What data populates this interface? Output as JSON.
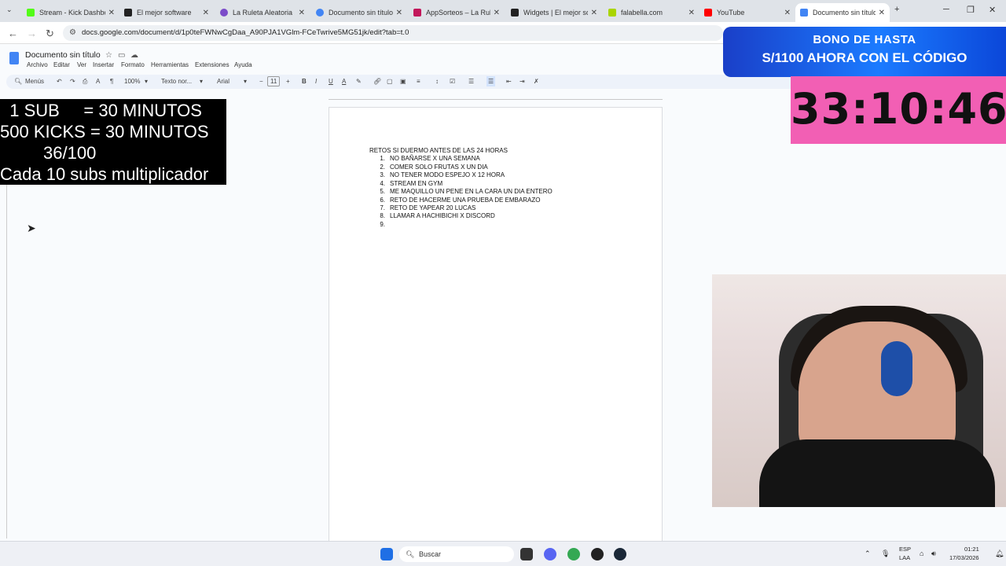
{
  "browser": {
    "tabs": [
      {
        "title": "Stream - Kick Dashboard",
        "color": "#53fc18"
      },
      {
        "title": "El mejor software",
        "color": "#222222"
      },
      {
        "title": "La Ruleta Aleatoria",
        "color": "#7b4cc9"
      },
      {
        "title": "Documento sin título",
        "color": "#4285f4"
      },
      {
        "title": "AppSorteos – La Ruleta",
        "color": "#c2185b"
      },
      {
        "title": "Widgets | El mejor so",
        "color": "#222222"
      },
      {
        "title": "falabella.com",
        "color": "#aad500"
      },
      {
        "title": "YouTube",
        "color": "#ff0000"
      },
      {
        "title": "Documento sin título",
        "color": "#4285f4"
      }
    ],
    "url": "docs.google.com/document/d/1p0teFWNwCgDaa_A90PJA1VGlm-FCeTwrive5MG51jk/edit?tab=t.0"
  },
  "docs": {
    "title": "Documento sin título",
    "menu": [
      "Archivo",
      "Editar",
      "Ver",
      "Insertar",
      "Formato",
      "Herramientas",
      "Extensiones",
      "Ayuda"
    ],
    "toolbar": {
      "menus": "Menús",
      "zoom": "100%",
      "style": "Texto nor...",
      "font": "Arial",
      "size": "11"
    }
  },
  "document": {
    "heading": "RETOS SI DUERMO ANTES DE LAS 24 HORAS",
    "items": [
      {
        "n": "1.",
        "text": "NO BAÑARSE X UNA SEMANA"
      },
      {
        "n": "2.",
        "text": "COMER SOLO FRUTAS X UN DIA"
      },
      {
        "n": "3.",
        "text": "NO TENER MODO ESPEJO X 12 HORA"
      },
      {
        "n": "4.",
        "text": "STREAM EN GYM"
      },
      {
        "n": "5.",
        "text": "ME MAQUILLO UN PENE EN LA CARA UN DIA ENTERO"
      },
      {
        "n": "6.",
        "text": "RETO DE HACERME UNA PRUEBA DE EMBARAZO"
      },
      {
        "n": "7.",
        "text": "RETO DE YAPEAR 20 LUCAS"
      },
      {
        "n": "8.",
        "text": "LLAMAR A HACHIBICHI X DISCORD"
      },
      {
        "n": "9.",
        "text": ""
      }
    ]
  },
  "overlay": {
    "subs": [
      "  1 SUB     = 30 MINUTOS",
      "500 KICKS = 30 MINUTOS",
      "         36/100",
      "Cada 10 subs multiplicador"
    ],
    "promo_line1": "BONO DE HASTA",
    "promo_line2": "S/1100 AHORA CON EL CÓDIGO",
    "timer": "33:10:46"
  },
  "taskbar": {
    "search_placeholder": "Buscar",
    "lang1": "ESP",
    "lang2": "LAA",
    "time": "01:21",
    "date": "17/03/2026"
  }
}
